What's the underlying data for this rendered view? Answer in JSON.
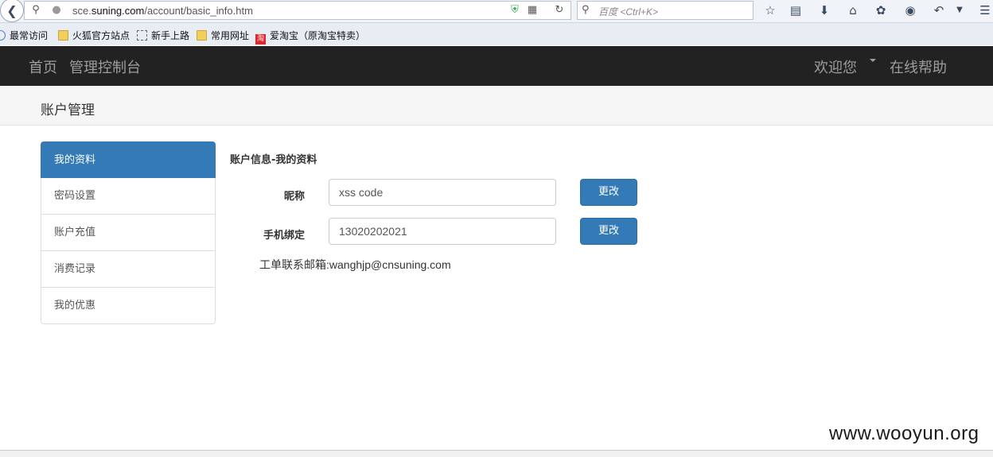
{
  "browser": {
    "url_prefix": "sce.",
    "url_domain": "suning.com",
    "url_path": "/account/basic_info.htm",
    "search_placeholder": "百度 <Ctrl+K>",
    "bookmarks": [
      "最常访问",
      "火狐官方站点",
      "新手上路",
      "常用网址",
      "爱淘宝（原淘宝特卖）"
    ],
    "taobao_glyph": "淘"
  },
  "navbar": {
    "home": "首页",
    "console": "管理控制台",
    "welcome": "欢迎您",
    "help": "在线帮助"
  },
  "page": {
    "title": "账户管理"
  },
  "sidebar": {
    "items": [
      {
        "label": "我的资料",
        "active": true
      },
      {
        "label": "密码设置"
      },
      {
        "label": "账户充值"
      },
      {
        "label": "消费记录"
      },
      {
        "label": "我的优惠"
      }
    ]
  },
  "form": {
    "section_title": "账户信息-我的资料",
    "nickname_label": "昵称",
    "nickname_value": "xss code",
    "phone_label": "手机绑定",
    "phone_value": "13020202021",
    "change_label": "更改",
    "contact": "工单联系邮箱:wanghjp@cnsuning.com"
  },
  "watermark": "www.wooyun.org",
  "colors": {
    "navbar_bg": "#222222",
    "primary": "#337ab7"
  }
}
